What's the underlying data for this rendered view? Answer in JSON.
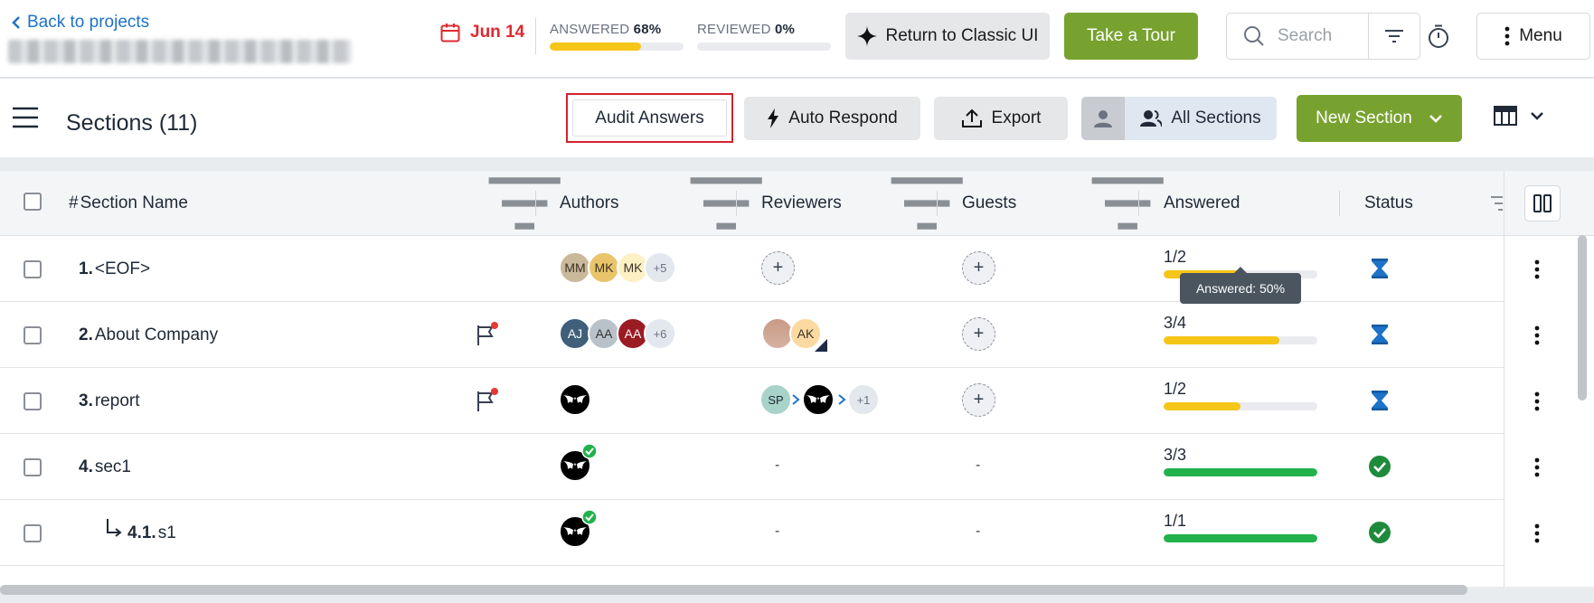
{
  "header": {
    "back_label": "Back to projects",
    "due_date": "Jun 14",
    "answered": {
      "label": "ANSWERED",
      "value": "68%",
      "fraction": 0.68
    },
    "reviewed": {
      "label": "REVIEWED",
      "value": "0%",
      "fraction": 0.0
    },
    "classic_label": "Return to Classic UI",
    "tour_label": "Take a Tour",
    "search_placeholder": "Search",
    "menu_label": "Menu"
  },
  "toolbar": {
    "title": "Sections (11)",
    "audit_label": "Audit Answers",
    "auto_label": "Auto Respond",
    "export_label": "Export",
    "all_sections_label": "All Sections",
    "new_section_label": "New Section"
  },
  "columns": {
    "hash": "#",
    "name": "Section Name",
    "authors": "Authors",
    "reviewers": "Reviewers",
    "guests": "Guests",
    "answered": "Answered",
    "status": "Status"
  },
  "rows": [
    {
      "num": "1.",
      "name": "<EOF>",
      "answered": "1/2",
      "fraction": 0.5,
      "status": "in-progress",
      "authors": [
        "MM",
        "MK",
        "MK"
      ],
      "authors_more": "+5"
    },
    {
      "num": "2.",
      "name": "About Company",
      "answered": "3/4",
      "fraction": 0.75,
      "status": "in-progress",
      "authors": [
        "AJ",
        "AA",
        "AA"
      ],
      "authors_more": "+6",
      "reviewers": [
        "AK"
      ]
    },
    {
      "num": "3.",
      "name": "report",
      "answered": "1/2",
      "fraction": 0.5,
      "status": "in-progress",
      "reviewers": [
        "SP"
      ],
      "reviewers_more": "+1"
    },
    {
      "num": "4.",
      "name": "sec1",
      "answered": "3/3",
      "fraction": 1.0,
      "status": "complete",
      "reviewers_empty": "-",
      "guests_empty": "-"
    },
    {
      "num": "4.1.",
      "name": "s1",
      "answered": "1/1",
      "fraction": 1.0,
      "status": "complete",
      "reviewers_empty": "-",
      "guests_empty": "-"
    }
  ],
  "tooltip": "Answered: 50%",
  "colors": {
    "accent_blue": "#1d72c9",
    "due_red": "#e0282f",
    "brand_green": "#78a22f",
    "progress_yellow": "#f5c518",
    "complete_green": "#22b24c",
    "status_blue": "#1d72c9",
    "highlight_red": "#d3232f"
  }
}
